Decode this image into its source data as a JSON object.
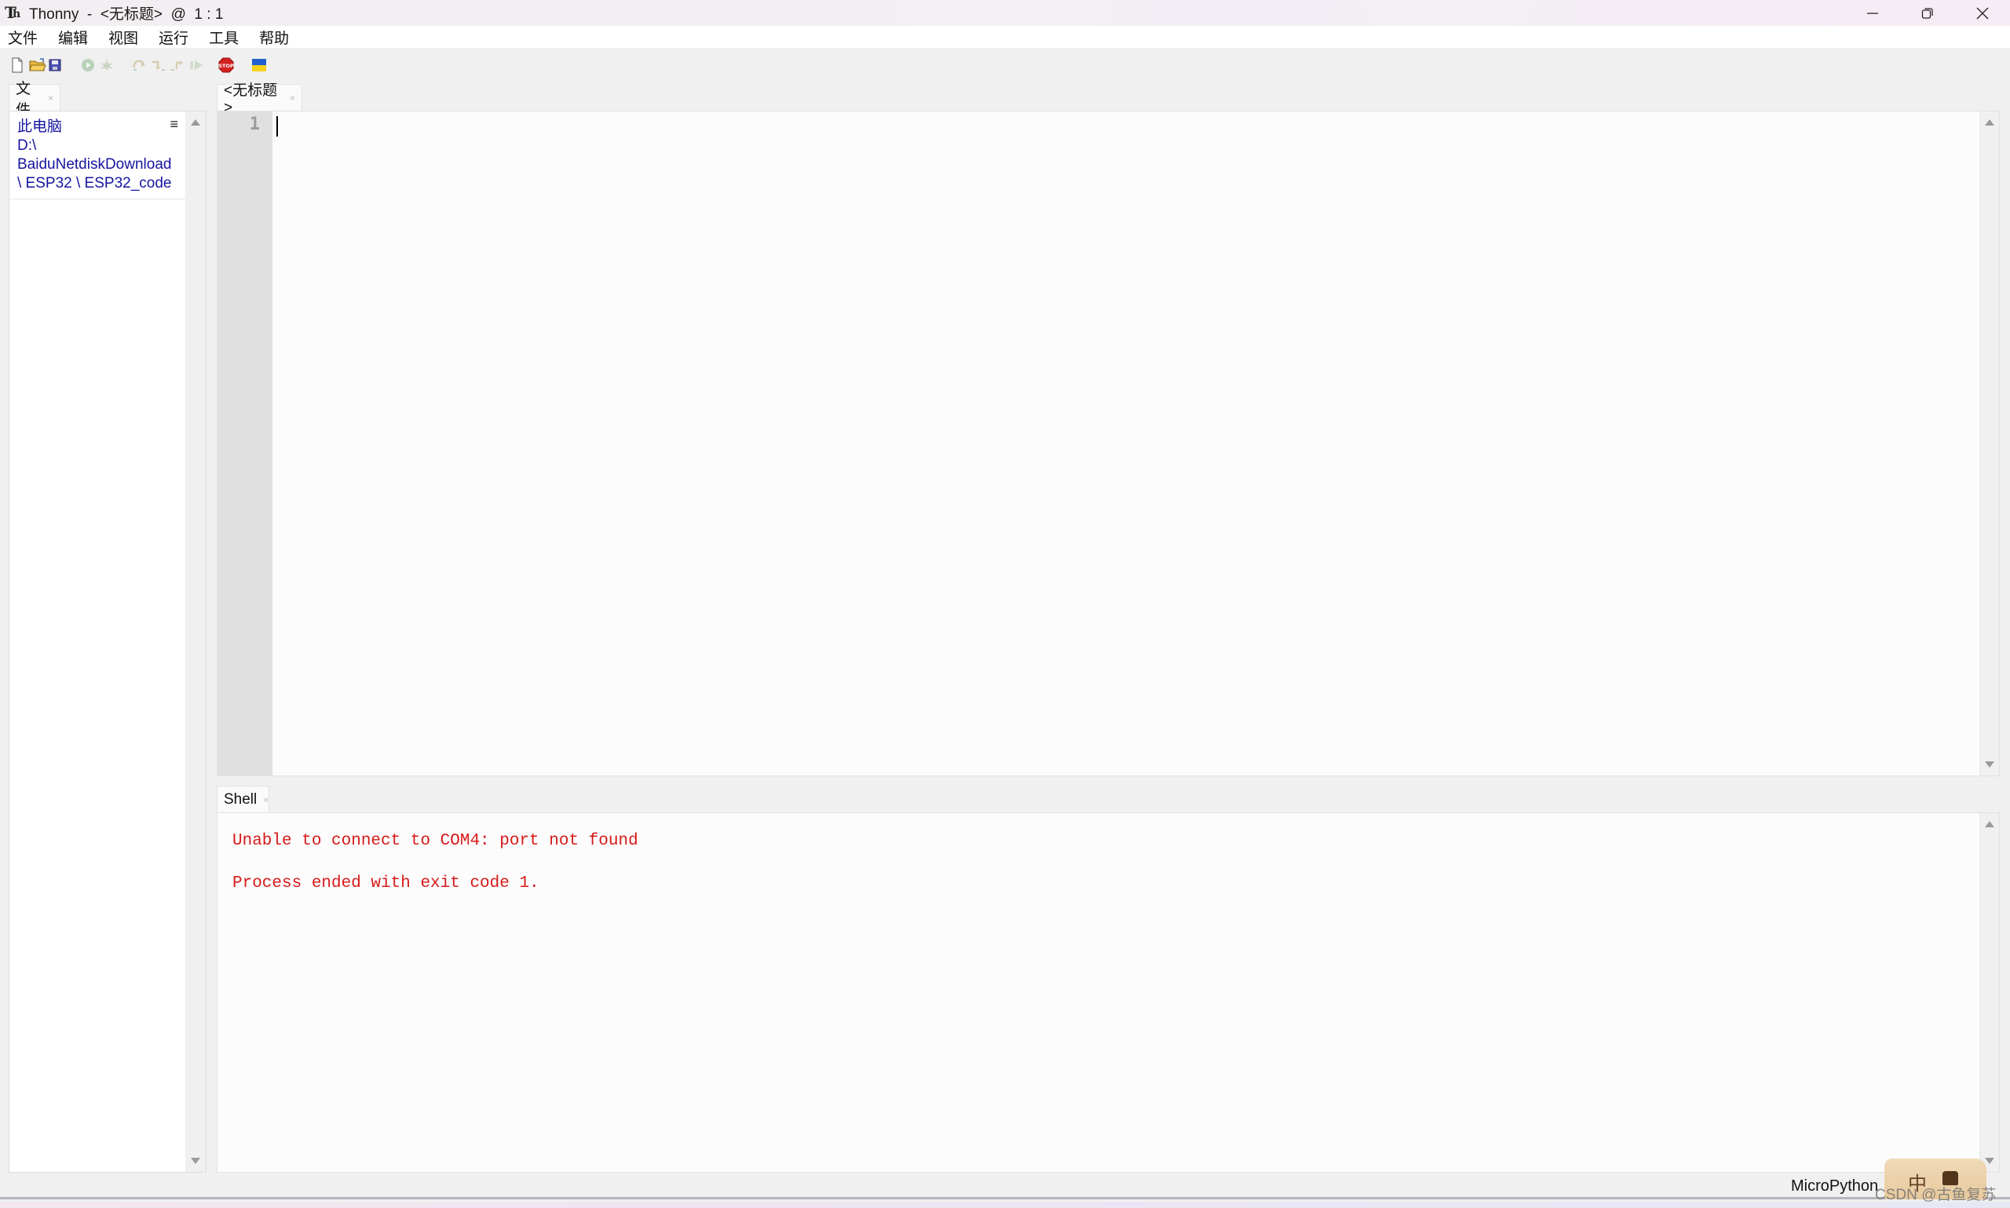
{
  "window": {
    "title": "Thonny  -  <无标题>  @  1 : 1",
    "app_icon": "thonny-logo-icon",
    "controls": [
      "minimize-icon",
      "restore-icon",
      "close-icon"
    ]
  },
  "menubar": {
    "items": [
      "文件",
      "编辑",
      "视图",
      "运行",
      "工具",
      "帮助"
    ]
  },
  "toolbar": {
    "buttons": [
      {
        "name": "new-file",
        "icon": "new-file-icon",
        "enabled": true
      },
      {
        "name": "open-file",
        "icon": "open-folder-icon",
        "enabled": true
      },
      {
        "name": "save-file",
        "icon": "save-disk-icon",
        "enabled": true
      },
      {
        "name": "run",
        "icon": "run-play-icon",
        "enabled": false
      },
      {
        "name": "debug",
        "icon": "bug-icon",
        "enabled": false
      },
      {
        "name": "step-over",
        "icon": "step-over-icon",
        "enabled": false
      },
      {
        "name": "step-into",
        "icon": "step-into-icon",
        "enabled": false
      },
      {
        "name": "step-out",
        "icon": "step-out-icon",
        "enabled": false
      },
      {
        "name": "resume",
        "icon": "resume-icon",
        "enabled": false
      },
      {
        "name": "stop",
        "icon": "stop-sign-icon",
        "enabled": true,
        "label": "STOP"
      },
      {
        "name": "ukraine-support",
        "icon": "ukraine-flag-icon",
        "enabled": true
      }
    ],
    "colors": {
      "stop": "#d42020",
      "flag_blue": "#1f5fd0",
      "flag_yellow": "#f7d21a"
    }
  },
  "files_panel": {
    "tab_label": "文件",
    "path_lines": [
      "此电脑",
      "D:\\",
      "BaiduNetdiskDownload",
      "\\ ESP32 \\ ESP32_code"
    ],
    "menu_icon": "hamburger-menu-icon"
  },
  "editor": {
    "tab_label": "<无标题>",
    "line_numbers": [
      "1"
    ],
    "content": ""
  },
  "shell": {
    "tab_label": "Shell",
    "lines": [
      "Unable to connect to COM4: port not found",
      "Process ended with exit code 1."
    ],
    "text_color": "#d71919"
  },
  "statusbar": {
    "backend": "MicroPython"
  },
  "overlay": {
    "ime_char": "中",
    "watermark": "CSDN @古鱼复苏"
  }
}
